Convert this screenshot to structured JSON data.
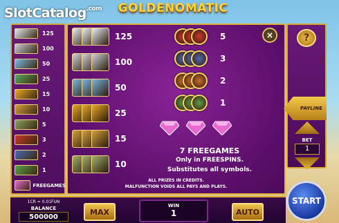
{
  "watermark": {
    "text": "SlotCatalog",
    "suffix": ".com"
  },
  "game_title": "GOLDENOMATIC",
  "left_paytable": [
    {
      "symbol": "yacht",
      "value": "125",
      "color": "#e0e6f0"
    },
    {
      "symbol": "limo",
      "value": "100",
      "color": "#c9c9d6"
    },
    {
      "symbol": "boat",
      "value": "50",
      "color": "#7ab6e0"
    },
    {
      "symbol": "villa",
      "value": "25",
      "color": "#5aa860"
    },
    {
      "symbol": "sports-car",
      "value": "15",
      "color": "#e8a62a"
    },
    {
      "symbol": "gold-bars",
      "value": "10",
      "color": "#d4a040"
    },
    {
      "symbol": "cash",
      "value": "5",
      "color": "#8aa060"
    },
    {
      "symbol": "ruby-coin",
      "value": "3",
      "color": "#c83a2a"
    },
    {
      "symbol": "blue-coin",
      "value": "2",
      "color": "#4a6ab0"
    },
    {
      "symbol": "green-coin",
      "value": "1",
      "color": "#5aa048"
    },
    {
      "symbol": "diamond",
      "value": "FREEGAMES",
      "color": "#e86ad0"
    }
  ],
  "paytable_left": [
    {
      "symbol": "yacht",
      "value": "125",
      "color": "#e8eef8"
    },
    {
      "symbol": "limo",
      "value": "100",
      "color": "#d0d0dc"
    },
    {
      "symbol": "boat",
      "value": "50",
      "color": "#7ab6e0"
    },
    {
      "symbol": "sports-car",
      "value": "25",
      "color": "#e8a62a"
    },
    {
      "symbol": "gold-bars",
      "value": "15",
      "color": "#d4a040"
    },
    {
      "symbol": "cash",
      "value": "10",
      "color": "#a0b070"
    }
  ],
  "paytable_right": [
    {
      "symbol": "ruby-coin",
      "value": "5",
      "color": "#c83a2a"
    },
    {
      "symbol": "blue-coin",
      "value": "3",
      "color": "#4a6ab0"
    },
    {
      "symbol": "bronze-coin",
      "value": "2",
      "color": "#c87030"
    },
    {
      "symbol": "green-coin",
      "value": "1",
      "color": "#5aa048"
    }
  ],
  "freegames": {
    "title": "7 FREEGAMES",
    "line1": "Only in FREESPINS.",
    "line2": "Substitutes all symbols."
  },
  "rules": {
    "line1": "ALL PRIZES IN CREDITS.",
    "line2": "MALFUNCTION VOIDS ALL PAYS AND PLAYS."
  },
  "close_label": "×",
  "help_label": "?",
  "payline_label": "PAYLINE",
  "bet": {
    "label": "BET",
    "value": "1"
  },
  "credit_rate": "1CR = 0.01FUN",
  "balance": {
    "label": "BALANCE",
    "value": "500000"
  },
  "max_label": "MAX",
  "win": {
    "label": "WIN",
    "value": "1"
  },
  "auto_label": "AUTO",
  "start_label": "START",
  "colors": {
    "gold": "#d9a830",
    "purple": "#5c0f6b",
    "diamond": "#e86ad0"
  }
}
